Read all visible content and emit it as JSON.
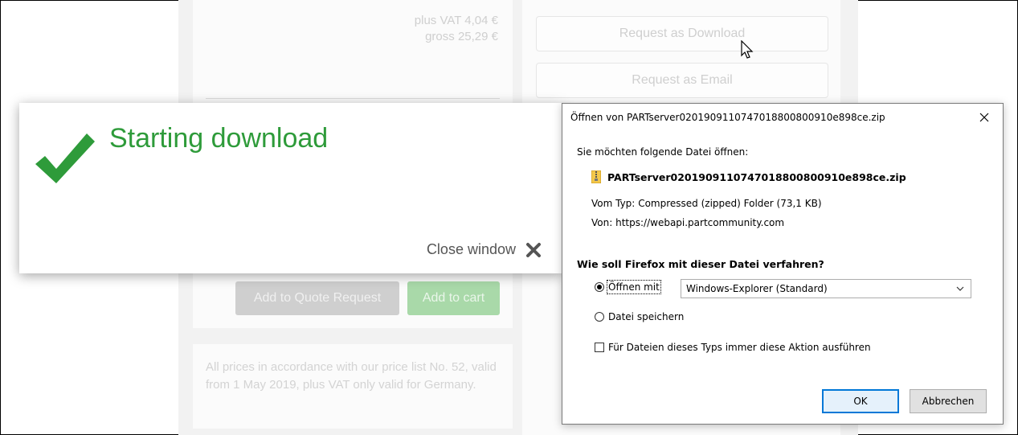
{
  "background": {
    "price_lines": [
      "plus VAT 4,04 €",
      "gross 25,29 €"
    ],
    "add_to_quote_label": "Add to Quote Request",
    "add_to_cart_label": "Add to cart",
    "notice": "All prices in accordance with our price list No. 52, valid from 1 May 2019, plus VAT only valid for Germany.",
    "request_download_label": "Request as Download",
    "request_email_label": "Request as Email"
  },
  "popup": {
    "title": "Starting download",
    "close_label": "Close window",
    "accent_color": "#2e9b3a"
  },
  "dialog": {
    "title": "Öffnen von PARTserver02019091107470188008009​10e898ce.zip",
    "question": "Sie möchten folgende Datei öffnen:",
    "filename": "PARTserver0201909110747018800800910e898ce.zip",
    "type_label": "Vom Typ:",
    "type_value": "Compressed (zipped) Folder (73,1 KB)",
    "from_label": "Von:",
    "from_value": "https://webapi.partcommunity.com",
    "action_question": "Wie soll Firefox mit dieser Datei verfahren?",
    "open_with_prefix": "",
    "open_with_label": "Öffnen mit",
    "open_with_selected": "Windows-Explorer (Standard)",
    "save_label": "Datei speichern",
    "always_label": "Für Dateien dieses Typs immer diese Aktion ausführen",
    "ok_label": "OK",
    "cancel_label": "Abbrechen"
  }
}
